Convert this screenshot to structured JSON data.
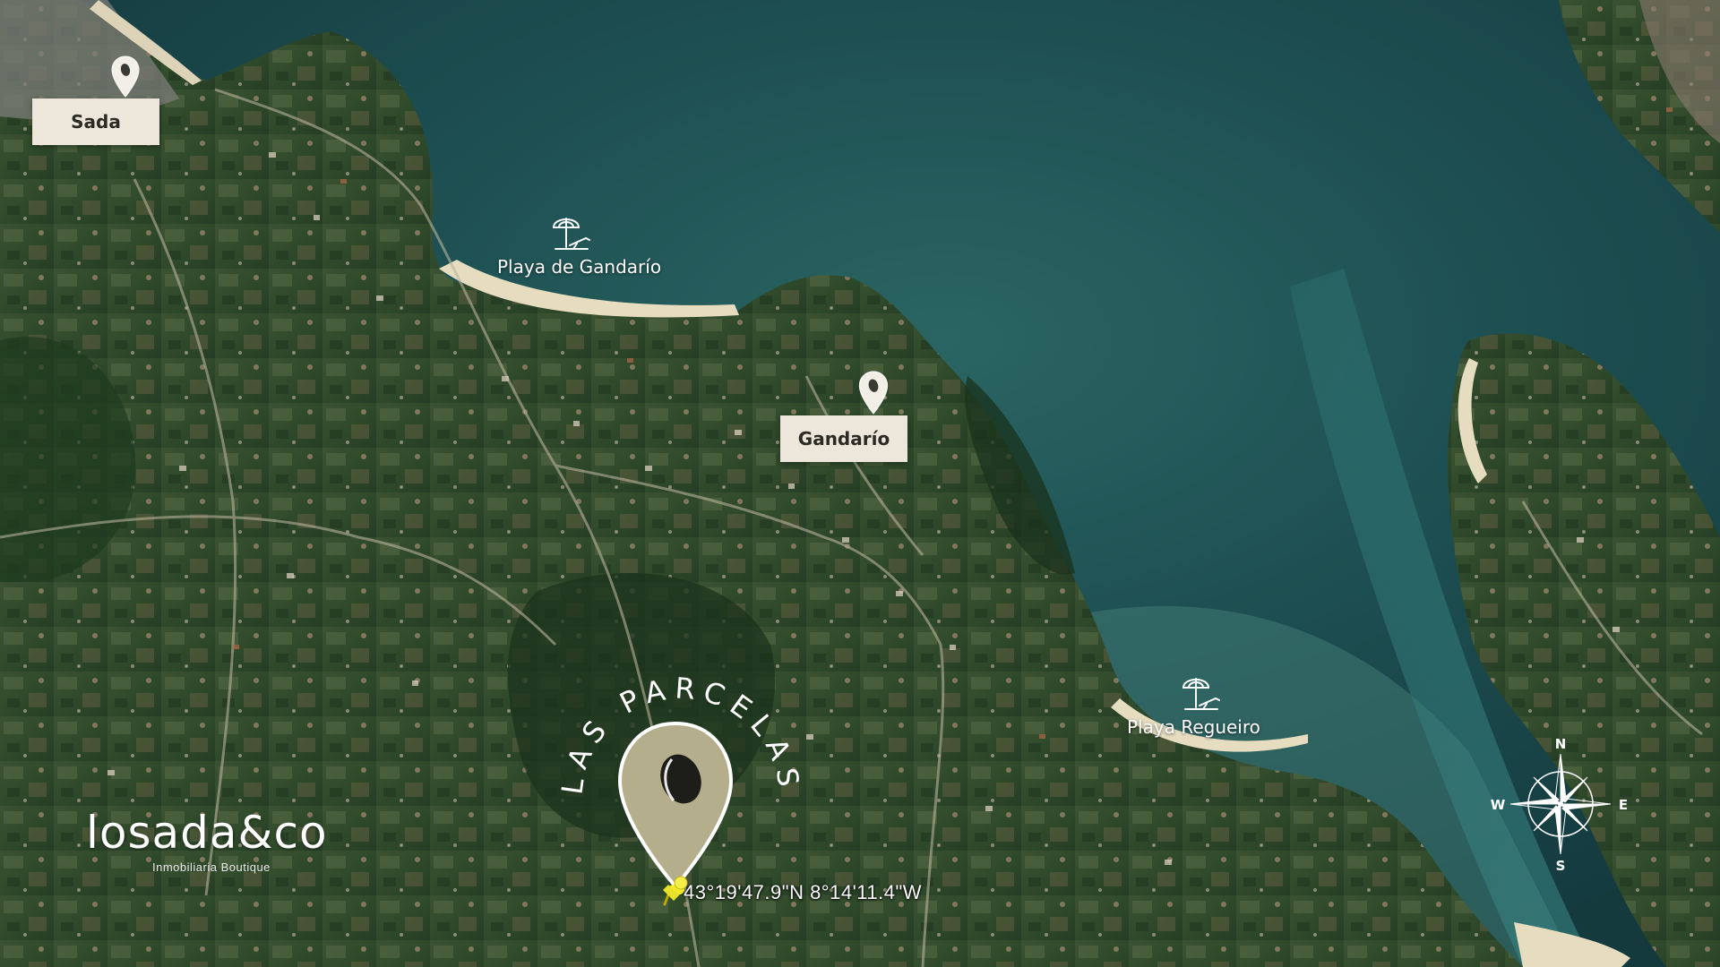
{
  "places": [
    {
      "id": "sada",
      "label": "Sada"
    },
    {
      "id": "gandario",
      "label": "Gandarío"
    }
  ],
  "beaches": [
    {
      "id": "gandario-beach",
      "label": "Playa de Gandarío",
      "icon": "beach-umbrella-icon"
    },
    {
      "id": "regueiro-beach",
      "label": "Playa Regueiro",
      "icon": "beach-umbrella-icon"
    }
  ],
  "parcel": {
    "arc_title": "LAS PARCELAS",
    "coordinates": "43°19'47.9\"N 8°14'11.4\"W",
    "pin_color": "#b5ae8c",
    "pushpin_color": "#e8e12b"
  },
  "brand": {
    "name": "losada&co",
    "tagline": "Inmobiliaria Boutique"
  },
  "compass": {
    "n": "N",
    "s": "S",
    "e": "E",
    "w": "W"
  },
  "colors": {
    "water": "#1d4c4d",
    "land": "#2f4a2c",
    "label_bg": "#ece7da"
  }
}
